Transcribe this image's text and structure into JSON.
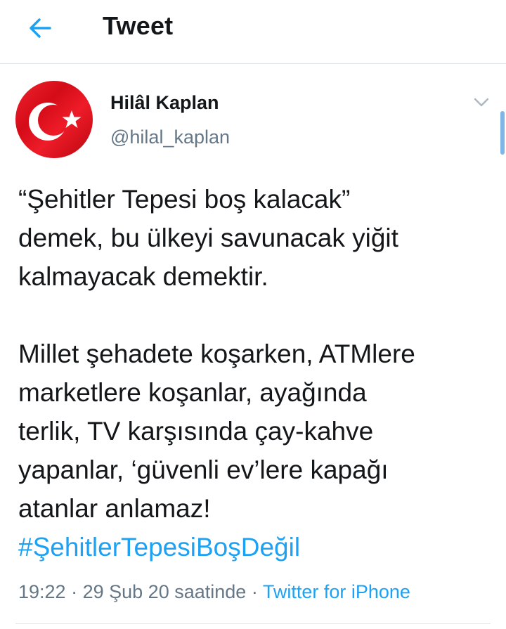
{
  "header": {
    "back_icon": "arrow-left-icon",
    "title": "Tweet"
  },
  "tweet": {
    "author": {
      "name": "Hilâl Kaplan",
      "handle": "@hilal_kaplan",
      "avatar": "turkish-flag-avatar"
    },
    "menu_icon": "chevron-down-icon",
    "paragraphs": [
      "“Şehitler Tepesi boş kalacak”\ndemek, bu ülkeyi savunacak yiğit\nkalmayacak demektir.",
      "Millet şehadete koşarken, ATMlere\nmarketlere koşanlar, ayağında\nterlik, TV karşısında çay-kahve\nyapanlar, ‘güvenli ev’lere kapağı\natanlar anlamaz!"
    ],
    "hashtag": "#ŞehitlerTepesiBoşDeğil",
    "time": "19:22",
    "separator": "·",
    "date": "29 Şub 20 saatinde",
    "source": "Twitter for iPhone"
  },
  "colors": {
    "accent": "#1da1f2",
    "secondary_text": "#657786",
    "divider": "#e1e8ed",
    "flag_red": "#e30a17"
  }
}
